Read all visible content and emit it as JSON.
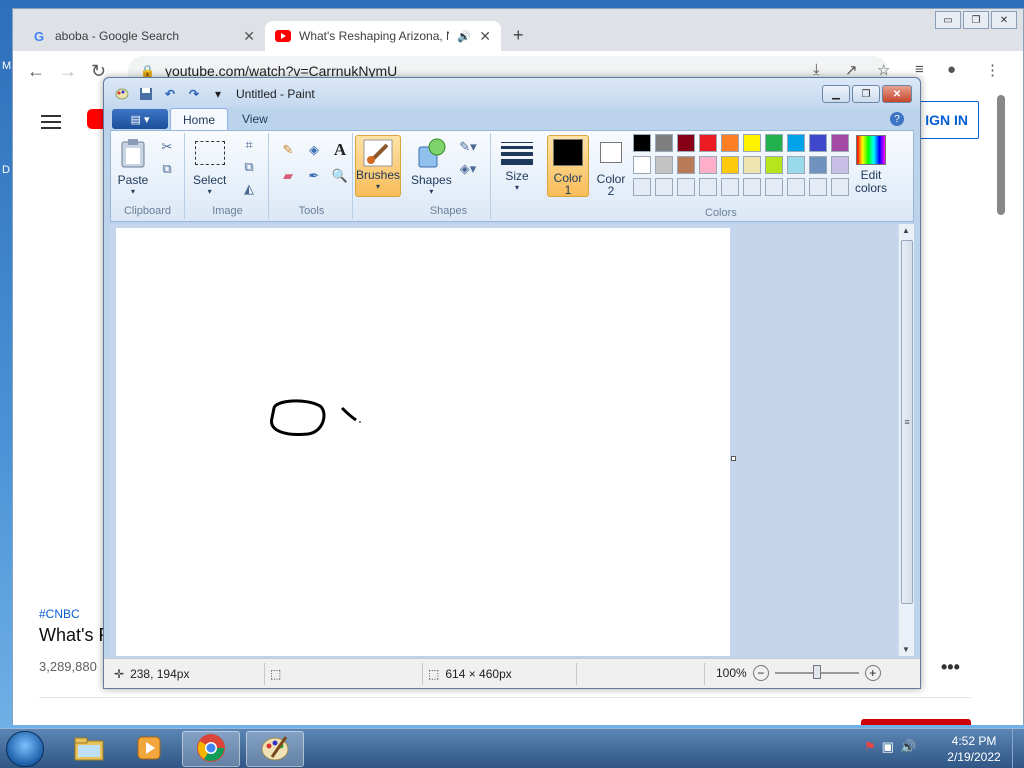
{
  "desktop": {
    "fragment_top": "M",
    "fragment_mid": "D"
  },
  "chrome": {
    "tabs": [
      {
        "title": "aboba - Google Search",
        "icon": "google-icon",
        "close": "✕"
      },
      {
        "title": "What's Reshaping Arizona, N",
        "icon": "youtube-icon",
        "audio": "🔊",
        "close": "✕"
      }
    ],
    "new_tab": "+",
    "window_buttons": [
      "▭",
      "❐",
      "✕"
    ],
    "address": "youtube.com/watch?v=CarrnukNymU",
    "page": {
      "signin_label": "IGN IN",
      "hashtag": "#CNBC",
      "video_title": "What's R",
      "views": "3,289,880",
      "more": "•••"
    }
  },
  "paint": {
    "title": "Untitled - Paint",
    "tabs": [
      "Home",
      "View"
    ],
    "menu_label": "▤ ▾",
    "help": "?",
    "groups": {
      "clipboard": {
        "label": "Clipboard",
        "paste": "Paste"
      },
      "image": {
        "label": "Image",
        "select": "Select"
      },
      "tools": {
        "label": "Tools"
      },
      "brushes": {
        "label": "Brushes"
      },
      "shapes": {
        "label": "Shapes",
        "button": "Shapes"
      },
      "size": {
        "label": "Size"
      },
      "colors": {
        "label": "Colors",
        "color1_line1": "Color",
        "color1_line2": "1",
        "color2_line1": "Color",
        "color2_line2": "2",
        "edit_line1": "Edit",
        "edit_line2": "colors",
        "color1": "#000000",
        "color2": "#ffffff",
        "palette_row1": [
          "#000000",
          "#7f7f7f",
          "#880015",
          "#ed1c24",
          "#ff7f27",
          "#fff200",
          "#22b14c",
          "#00a2e8",
          "#3f48cc",
          "#a349a4"
        ],
        "palette_row2": [
          "#ffffff",
          "#c3c3c3",
          "#b97a57",
          "#ffaec9",
          "#ffc90e",
          "#efe4b0",
          "#b5e61d",
          "#99d9ea",
          "#7092be",
          "#c8bfe7"
        ]
      }
    },
    "status": {
      "cursor_pos": "238, 194px",
      "canvas_size": "614 × 460px",
      "zoom": "100%",
      "zoom_level_percent": 100
    }
  },
  "taskbar": {
    "apps": [
      "explorer-icon",
      "media-player-icon",
      "chrome-icon",
      "paint-icon"
    ],
    "time": "4:52 PM",
    "date": "2/19/2022"
  }
}
